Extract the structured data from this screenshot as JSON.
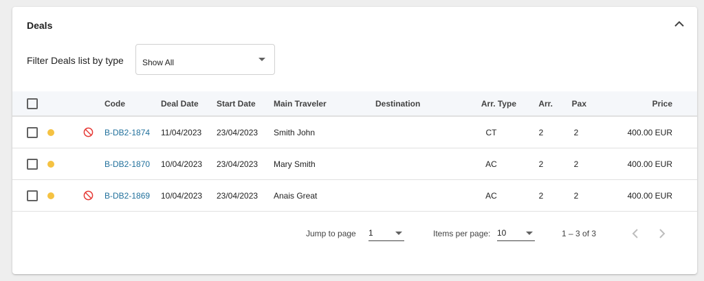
{
  "card": {
    "title": "Deals"
  },
  "filter": {
    "label": "Filter Deals list by type",
    "selected": "Show All"
  },
  "table": {
    "headers": {
      "code": "Code",
      "deal_date": "Deal Date",
      "start_date": "Start Date",
      "main_traveler": "Main Traveler",
      "destination": "Destination",
      "arr_type": "Arr. Type",
      "arr": "Arr.",
      "pax": "Pax",
      "price": "Price"
    },
    "rows": [
      {
        "code": "B-DB2-1874",
        "deal_date": "11/04/2023",
        "start_date": "23/04/2023",
        "main_traveler": "Smith John",
        "destination": "",
        "arr_type": "CT",
        "arr": "2",
        "pax": "2",
        "price": "400.00 EUR",
        "blocked": true
      },
      {
        "code": "B-DB2-1870",
        "deal_date": "10/04/2023",
        "start_date": "23/04/2023",
        "main_traveler": "Mary Smith",
        "destination": "",
        "arr_type": "AC",
        "arr": "2",
        "pax": "2",
        "price": "400.00 EUR",
        "blocked": false
      },
      {
        "code": "B-DB2-1869",
        "deal_date": "10/04/2023",
        "start_date": "23/04/2023",
        "main_traveler": "Anais Great",
        "destination": "",
        "arr_type": "AC",
        "arr": "2",
        "pax": "2",
        "price": "400.00 EUR",
        "blocked": true
      }
    ]
  },
  "pagination": {
    "jump_label": "Jump to page",
    "jump_value": "1",
    "items_label": "Items per page:",
    "items_value": "10",
    "range": "1 – 3 of 3"
  },
  "colors": {
    "status_dot": "#f5c242",
    "blocked_icon": "#e53935",
    "link": "#1f6f9b"
  },
  "icons": {
    "collapse": "chevron-up-icon",
    "blocked": "no-entry-icon",
    "prev": "chevron-left-icon",
    "next": "chevron-right-icon"
  }
}
